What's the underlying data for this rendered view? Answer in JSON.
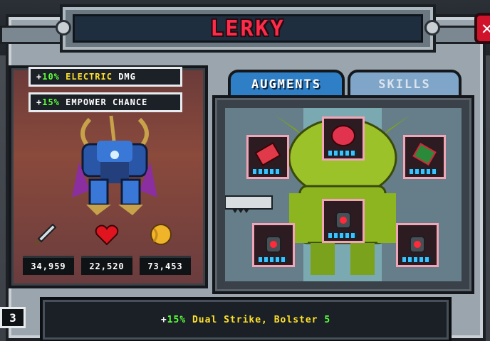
{
  "hero": {
    "name": "LERKY"
  },
  "bonuses": [
    {
      "prefix": "+",
      "value": "10%",
      "type": "ELECTRIC",
      "suffix": "DMG"
    },
    {
      "prefix": "+",
      "value": "15%",
      "type": "",
      "suffix": "EMPOWER CHANCE"
    }
  ],
  "stats": [
    {
      "icon": "sword-icon",
      "value": "34,959"
    },
    {
      "icon": "heart-icon",
      "value": "22,520"
    },
    {
      "icon": "armor-icon",
      "value": "73,453"
    }
  ],
  "tabs": [
    {
      "label": "AUGMENTS",
      "active": true
    },
    {
      "label": "SKILLS",
      "active": false
    }
  ],
  "augments": [
    {
      "slot": "head",
      "icon": "heart-core-icon"
    },
    {
      "slot": "left-arm",
      "icon": "red-chip-icon"
    },
    {
      "slot": "right-arm",
      "icon": "green-chip-icon"
    },
    {
      "slot": "chest",
      "icon": "potion-icon"
    },
    {
      "slot": "left-leg",
      "icon": "potion-icon"
    },
    {
      "slot": "right-leg",
      "icon": "potion-icon"
    }
  ],
  "footer": {
    "level": "3",
    "bonus_prefix": "+",
    "bonus_value": "15%",
    "bonus_names": "Dual Strike, Bolster",
    "bonus_level": "5"
  },
  "colors": {
    "name": "#ff2b4a",
    "accent_green": "#5cff3a",
    "accent_yellow": "#ffe02c",
    "tab_active": "#2f7fc6"
  }
}
